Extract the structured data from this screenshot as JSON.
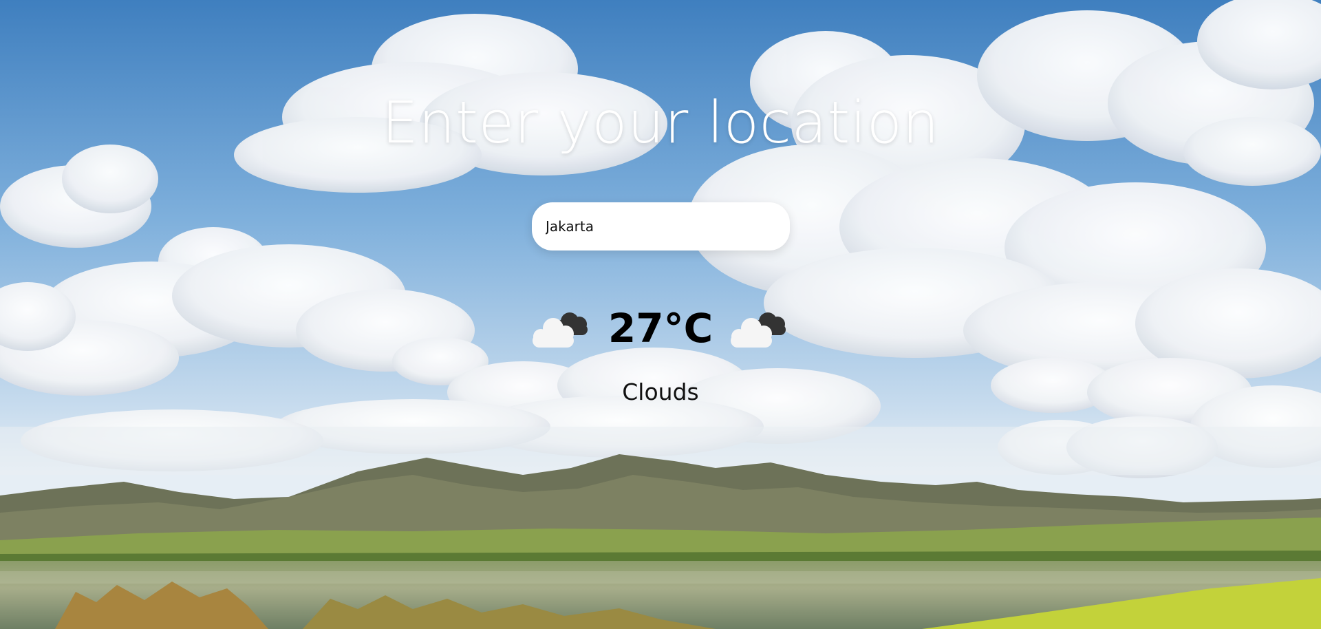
{
  "app": {
    "heading": "Enter your location"
  },
  "search": {
    "value": "Jakarta",
    "placeholder": ""
  },
  "weather": {
    "temperature": "27°C",
    "condition": "Clouds",
    "icon_left": "cloud-icon",
    "icon_right": "cloud-icon"
  },
  "colors": {
    "heading_text": "#ffffff",
    "input_background": "#ffffff",
    "temperature_text": "#000000",
    "condition_text": "#111111"
  }
}
